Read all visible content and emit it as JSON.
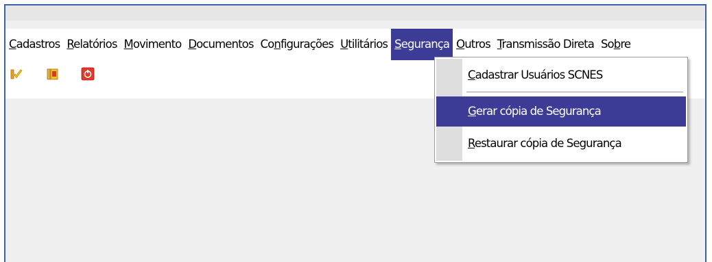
{
  "menubar": {
    "items": [
      {
        "pre": "",
        "u": "C",
        "post": "adastros"
      },
      {
        "pre": "",
        "u": "R",
        "post": "elatórios"
      },
      {
        "pre": "",
        "u": "M",
        "post": "ovimento"
      },
      {
        "pre": "",
        "u": "D",
        "post": "ocumentos"
      },
      {
        "pre": "Co",
        "u": "n",
        "post": "figurações"
      },
      {
        "pre": "",
        "u": "U",
        "post": "tilitários"
      },
      {
        "pre": "",
        "u": "S",
        "post": "egurança"
      },
      {
        "pre": "",
        "u": "O",
        "post": "utros"
      },
      {
        "pre": "",
        "u": "T",
        "post": "ransmissão Direta"
      },
      {
        "pre": "So",
        "u": "b",
        "post": "re"
      }
    ]
  },
  "toolbar": {
    "buttons": [
      "edit-icon",
      "clipboard-icon",
      "power-icon"
    ]
  },
  "dropdown": {
    "items": [
      {
        "pre": "",
        "u": "C",
        "post": "adastrar Usuários SCNES"
      },
      {
        "pre": "",
        "u": "G",
        "post": "erar cópia de Segurança"
      },
      {
        "pre": "",
        "u": "R",
        "post": "estaurar cópia de Segurança"
      }
    ]
  },
  "colors": {
    "highlight": "#3c3c96",
    "frame_border": "#3b5fa6"
  }
}
